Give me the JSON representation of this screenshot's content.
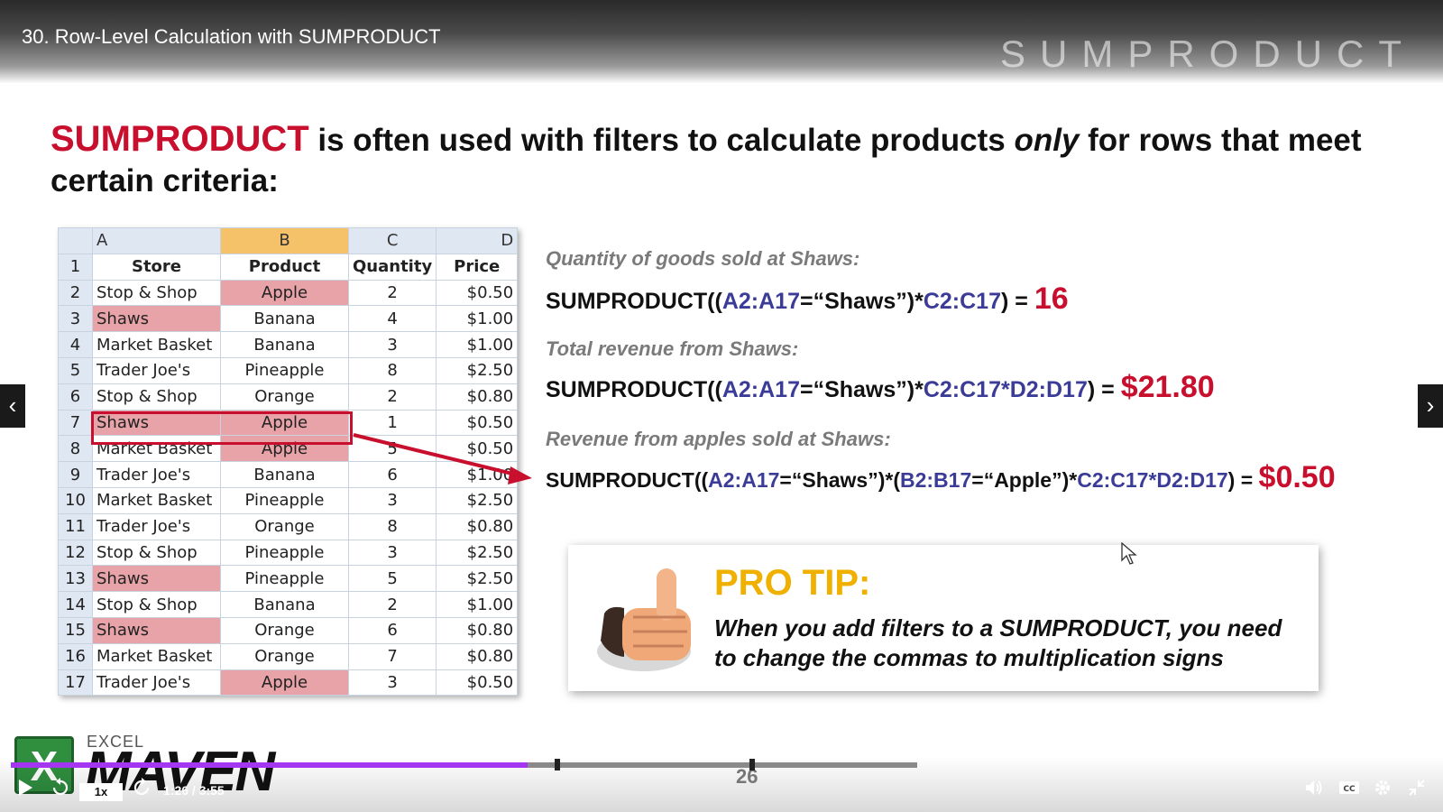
{
  "video": {
    "title": "30. Row-Level Calculation with SUMPRODUCT",
    "slide_watermark": "SUMPRODUCT"
  },
  "slide": {
    "heading": {
      "keyword": "SUMPRODUCT",
      "text_before_italic": " is often used with filters to calculate products ",
      "italic": "only",
      "text_after_italic": " for rows that meet certain criteria:"
    },
    "sheet": {
      "col_letters": [
        "A",
        "B",
        "C",
        "D"
      ],
      "selected_column": "B",
      "headers": [
        "Store",
        "Product",
        "Quantity",
        "Price"
      ],
      "rows": [
        {
          "n": "2",
          "store": "Stop & Shop",
          "product": "Apple",
          "qty": "2",
          "price": "$0.50",
          "hl_store": false,
          "hl_product": true
        },
        {
          "n": "3",
          "store": "Shaws",
          "product": "Banana",
          "qty": "4",
          "price": "$1.00",
          "hl_store": true,
          "hl_product": false
        },
        {
          "n": "4",
          "store": "Market Basket",
          "product": "Banana",
          "qty": "3",
          "price": "$1.00",
          "hl_store": false,
          "hl_product": false
        },
        {
          "n": "5",
          "store": "Trader Joe's",
          "product": "Pineapple",
          "qty": "8",
          "price": "$2.50",
          "hl_store": false,
          "hl_product": false
        },
        {
          "n": "6",
          "store": "Stop & Shop",
          "product": "Orange",
          "qty": "2",
          "price": "$0.80",
          "hl_store": false,
          "hl_product": false
        },
        {
          "n": "7",
          "store": "Shaws",
          "product": "Apple",
          "qty": "1",
          "price": "$0.50",
          "hl_store": true,
          "hl_product": true
        },
        {
          "n": "8",
          "store": "Market Basket",
          "product": "Apple",
          "qty": "5",
          "price": "$0.50",
          "hl_store": false,
          "hl_product": true
        },
        {
          "n": "9",
          "store": "Trader Joe's",
          "product": "Banana",
          "qty": "6",
          "price": "$1.00",
          "hl_store": false,
          "hl_product": false
        },
        {
          "n": "10",
          "store": "Market Basket",
          "product": "Pineapple",
          "qty": "3",
          "price": "$2.50",
          "hl_store": false,
          "hl_product": false
        },
        {
          "n": "11",
          "store": "Trader Joe's",
          "product": "Orange",
          "qty": "8",
          "price": "$0.80",
          "hl_store": false,
          "hl_product": false
        },
        {
          "n": "12",
          "store": "Stop & Shop",
          "product": "Pineapple",
          "qty": "3",
          "price": "$2.50",
          "hl_store": false,
          "hl_product": false
        },
        {
          "n": "13",
          "store": "Shaws",
          "product": "Pineapple",
          "qty": "5",
          "price": "$2.50",
          "hl_store": true,
          "hl_product": false
        },
        {
          "n": "14",
          "store": "Stop & Shop",
          "product": "Banana",
          "qty": "2",
          "price": "$1.00",
          "hl_store": false,
          "hl_product": false
        },
        {
          "n": "15",
          "store": "Shaws",
          "product": "Orange",
          "qty": "6",
          "price": "$0.80",
          "hl_store": true,
          "hl_product": false
        },
        {
          "n": "16",
          "store": "Market Basket",
          "product": "Orange",
          "qty": "7",
          "price": "$0.80",
          "hl_store": false,
          "hl_product": false
        },
        {
          "n": "17",
          "store": "Trader Joe's",
          "product": "Apple",
          "qty": "3",
          "price": "$0.50",
          "hl_store": false,
          "hl_product": true
        }
      ]
    },
    "formulas": [
      {
        "label": "Quantity of goods sold at Shaws:",
        "parts": [
          {
            "t": "SUMPRODUCT((",
            "c": "fn"
          },
          {
            "t": "A2:A17",
            "c": "rng"
          },
          {
            "t": "=“Shaws”)*",
            "c": "fn"
          },
          {
            "t": "C2:C17",
            "c": "rng"
          },
          {
            "t": ") = ",
            "c": "fn"
          },
          {
            "t": "16",
            "c": "res"
          }
        ]
      },
      {
        "label": "Total revenue from Shaws:",
        "parts": [
          {
            "t": "SUMPRODUCT((",
            "c": "fn"
          },
          {
            "t": "A2:A17",
            "c": "rng"
          },
          {
            "t": "=“Shaws”)*",
            "c": "fn"
          },
          {
            "t": "C2:C17*D2:D17",
            "c": "rng"
          },
          {
            "t": ") = ",
            "c": "fn"
          },
          {
            "t": "$21.80",
            "c": "res"
          }
        ]
      },
      {
        "label": "Revenue from apples sold at Shaws:",
        "parts": [
          {
            "t": "SUMPRODUCT((",
            "c": "fn"
          },
          {
            "t": "A2:A17",
            "c": "rng"
          },
          {
            "t": "=“Shaws”)*(",
            "c": "fn"
          },
          {
            "t": "B2:B17",
            "c": "rng"
          },
          {
            "t": "=“Apple”)*",
            "c": "fn"
          },
          {
            "t": "C2:C17*D2:D17",
            "c": "rng"
          },
          {
            "t": ") = ",
            "c": "fn"
          },
          {
            "t": "$0.50",
            "c": "res"
          }
        ]
      }
    ],
    "pro_tip": {
      "title": "PRO TIP:",
      "text": "When you add filters to a SUMPRODUCT, you need to change the commas to multiplication signs"
    },
    "logo": {
      "top": "EXCEL",
      "main": "MAVEN",
      "badge": "X"
    },
    "page_number": "26"
  },
  "player": {
    "speed": "1x",
    "time": "1:26 / 3:55",
    "progress_fraction": 0.57,
    "chapter_marks_fraction": [
      0.6,
      0.815
    ],
    "prev_icon": "chevron-left-icon",
    "next_icon": "chevron-right-icon"
  },
  "colors": {
    "accent_red": "#c8102e",
    "range_blue": "#3b3b98",
    "protip_gold": "#f0b000",
    "progress_purple": "#a435f0",
    "highlight_pink": "#e8a3a8"
  }
}
